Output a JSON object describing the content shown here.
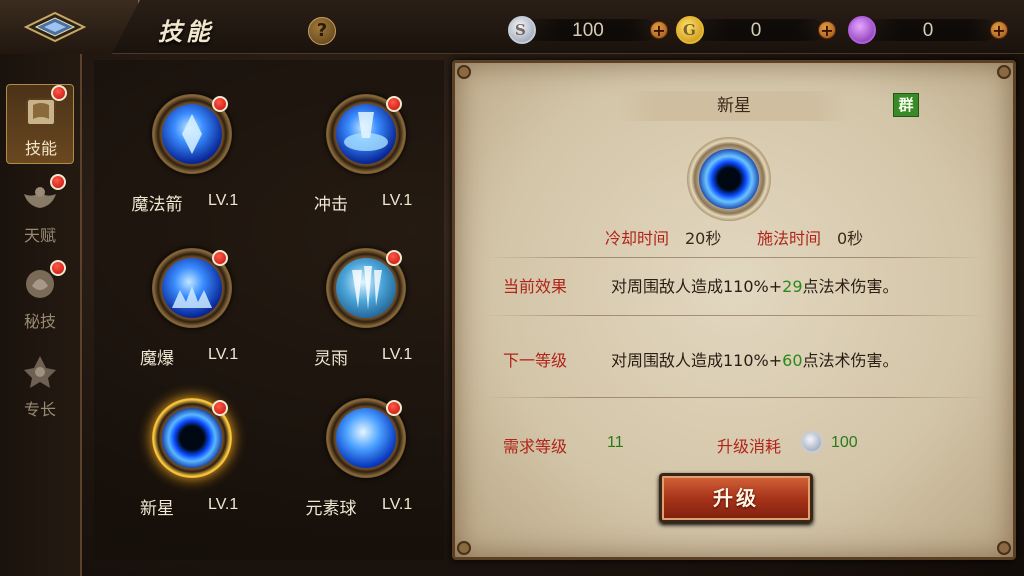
{
  "header": {
    "title": "技能",
    "help_label": "?",
    "currencies": [
      {
        "name": "silver",
        "icon": "silver-coin-icon",
        "value": "100",
        "plus": "+"
      },
      {
        "name": "gold",
        "icon": "gold-coin-icon",
        "value": "0",
        "plus": "+"
      },
      {
        "name": "gem",
        "icon": "purple-gem-icon",
        "value": "0",
        "plus": "+"
      }
    ]
  },
  "sidebar": {
    "items": [
      {
        "label": "技能",
        "active": true,
        "badge": true
      },
      {
        "label": "天赋",
        "active": false,
        "badge": true
      },
      {
        "label": "秘技",
        "active": false,
        "badge": true
      },
      {
        "label": "专长",
        "active": false,
        "badge": false
      }
    ]
  },
  "skills": [
    {
      "name": "魔法箭",
      "level": "LV.1",
      "badge": true
    },
    {
      "name": "冲击",
      "level": "LV.1",
      "badge": true
    },
    {
      "name": "魔爆",
      "level": "LV.1",
      "badge": true
    },
    {
      "name": "灵雨",
      "level": "LV.1",
      "badge": true
    },
    {
      "name": "新星",
      "level": "LV.1",
      "badge": true,
      "selected": true
    },
    {
      "name": "元素球",
      "level": "LV.1",
      "badge": true
    }
  ],
  "detail": {
    "skill_name": "新星",
    "tag": "群",
    "cooldown_label": "冷却时间",
    "cooldown_value": "20秒",
    "cast_label": "施法时间",
    "cast_value": "0秒",
    "current_label": "当前效果",
    "current_prefix": "对周围敌人造成110%+",
    "current_bonus": "29",
    "current_suffix": "点法术伤害。",
    "next_label": "下一等级",
    "next_prefix": "对周围敌人造成110%+",
    "next_bonus": "60",
    "next_suffix": "点法术伤害。",
    "req_level_label": "需求等级",
    "req_level_value": "11",
    "cost_label": "升级消耗",
    "cost_value": "100",
    "upgrade_label": "升级"
  },
  "colors": {
    "accent_red": "#b0241a",
    "bonus_green": "#2a8a1a",
    "button_orange": "#a8341a"
  }
}
